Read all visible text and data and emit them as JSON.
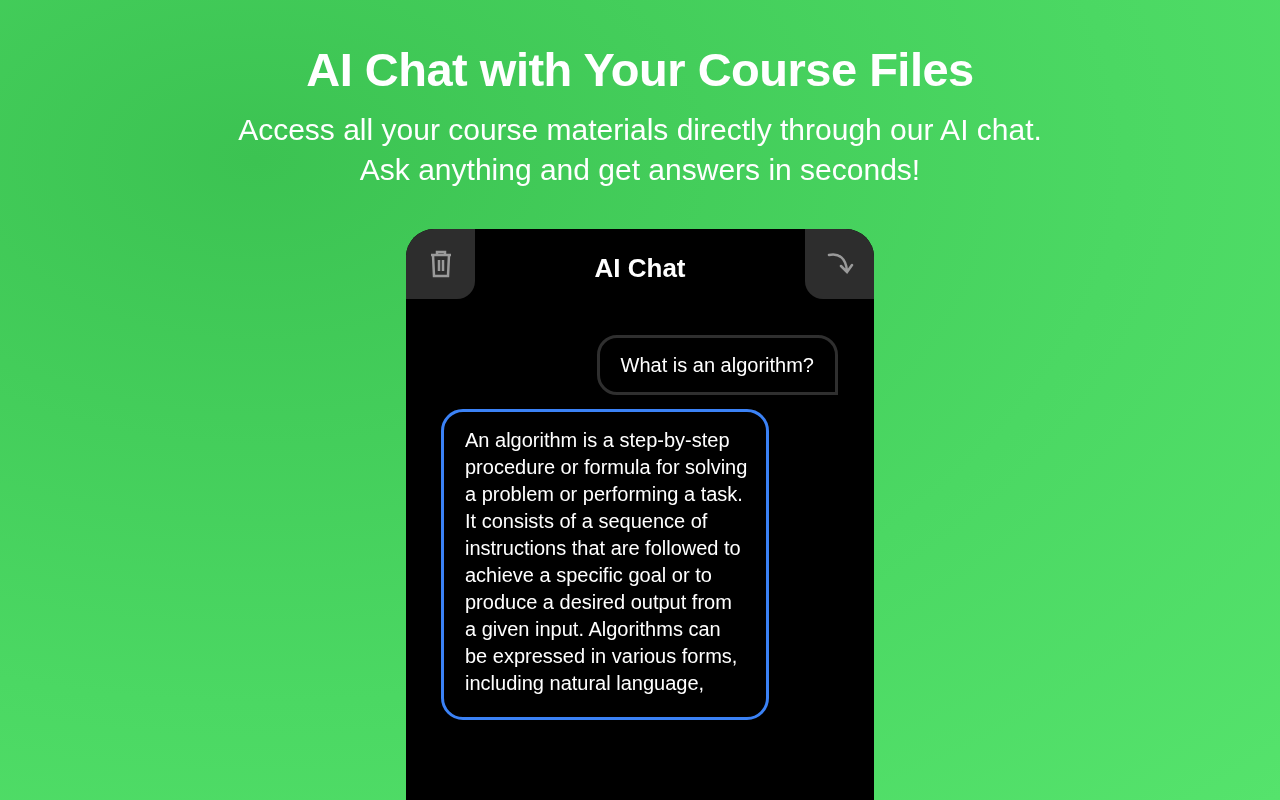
{
  "hero": {
    "title": "AI Chat with Your Course Files",
    "subtitle_lines": [
      "Access all your course materials directly through our AI chat.",
      "Ask anything and get answers in seconds!"
    ]
  },
  "chat": {
    "title": "AI Chat",
    "messages": [
      {
        "kind": "user",
        "text": "What is an algorithm?"
      },
      {
        "kind": "assistant",
        "text": "An algorithm is a step-by-step procedure or formula for solving a problem or performing a task. It consists of a sequence of instructions that are followed to achieve a specific goal or to produce a desired output from a given input. Algorithms can be expressed in various forms, including natural language,"
      }
    ]
  }
}
